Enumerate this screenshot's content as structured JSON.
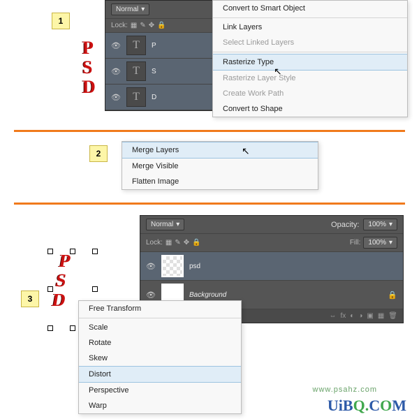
{
  "step1": {
    "num": "1",
    "psd": [
      "P",
      "S",
      "D"
    ],
    "panel": {
      "blend": "Normal",
      "lock": "Lock:",
      "layers": [
        {
          "n": "P"
        },
        {
          "n": "S"
        },
        {
          "n": "D"
        }
      ]
    },
    "menu": [
      "Convert to Smart Object",
      "Link Layers",
      "Select Linked Layers",
      "Rasterize Type",
      "Rasterize Layer Style",
      "Create Work Path",
      "Convert to Shape"
    ],
    "hl": 3,
    "disabled": [
      2,
      4,
      5
    ]
  },
  "step2": {
    "num": "2",
    "menu": [
      "Merge Layers",
      "Merge Visible",
      "Flatten Image"
    ],
    "hl": 0
  },
  "step3": {
    "num": "3",
    "psd": [
      "P",
      "S",
      "D"
    ],
    "panel": {
      "blend": "Normal",
      "opacity_l": "Opacity:",
      "opacity_v": "100%",
      "lock": "Lock:",
      "fill_l": "Fill:",
      "fill_v": "100%",
      "layers": [
        {
          "n": "psd"
        },
        {
          "n": "Background",
          "italic": true
        }
      ]
    },
    "menu": [
      "Free Transform",
      "Scale",
      "Rotate",
      "Skew",
      "Distort",
      "Perspective",
      "Warp"
    ],
    "hl": 4
  },
  "logo": {
    "t1": "UiB",
    "t2": "Q.",
    "t3": "C",
    "t4": "O",
    "t5": "M"
  },
  "watermark": "www.psahz.com"
}
